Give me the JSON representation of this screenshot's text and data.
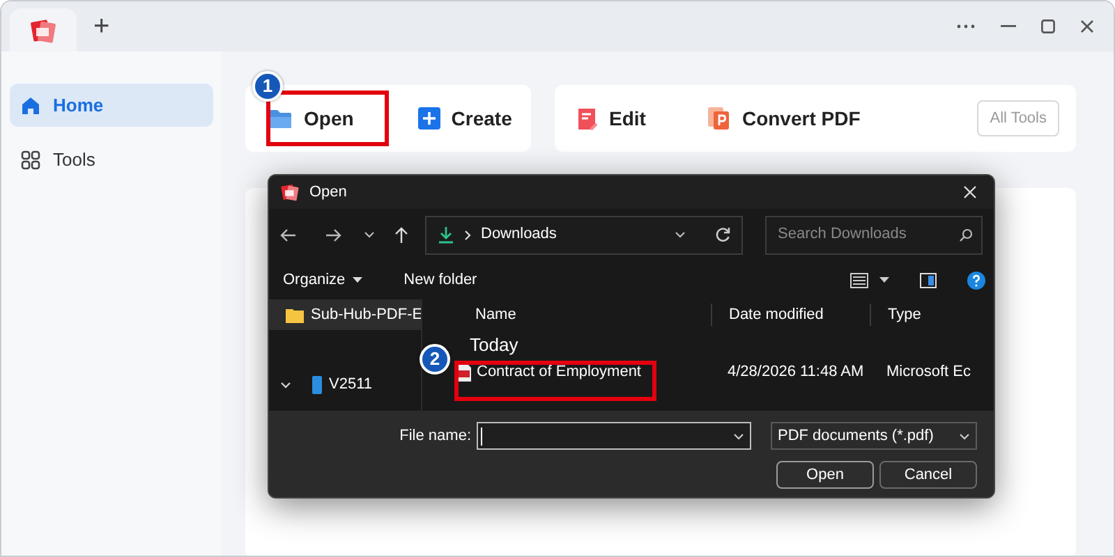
{
  "tab_bar": {
    "new_tab": "+"
  },
  "sidebar": {
    "items": [
      {
        "label": "Home",
        "kind": "home",
        "selected": true
      },
      {
        "label": "Tools",
        "kind": "tools",
        "selected": false
      }
    ]
  },
  "quick_actions": [
    {
      "label": "Open",
      "kind": "open"
    },
    {
      "label": "Create",
      "kind": "create"
    }
  ],
  "tools": [
    {
      "label": "Edit",
      "kind": "edit"
    },
    {
      "label": "Convert PDF",
      "kind": "convert"
    }
  ],
  "all_tools": "All Tools",
  "steps": [
    "1",
    "2"
  ],
  "dialog": {
    "title": "Open",
    "path": "Downloads",
    "search": {
      "placeholder": "Search Downloads"
    },
    "organize": "Organize",
    "new_folder": "New folder",
    "nav": [
      {
        "label": "Sub-Hub-PDF-E",
        "kind": "folder",
        "selected": true
      },
      {
        "label": "V2511",
        "kind": "drive",
        "selected": false
      }
    ],
    "columns": [
      "Name",
      "Date modified",
      "Type"
    ],
    "group": "Today",
    "files": [
      {
        "name": "Contract of Employment",
        "date": "4/28/2026 11:48 AM",
        "type": "Microsoft Ec"
      }
    ],
    "file_name_label": "File name:",
    "file_type": "PDF documents (*.pdf)",
    "buttons": [
      "Open",
      "Cancel"
    ]
  }
}
